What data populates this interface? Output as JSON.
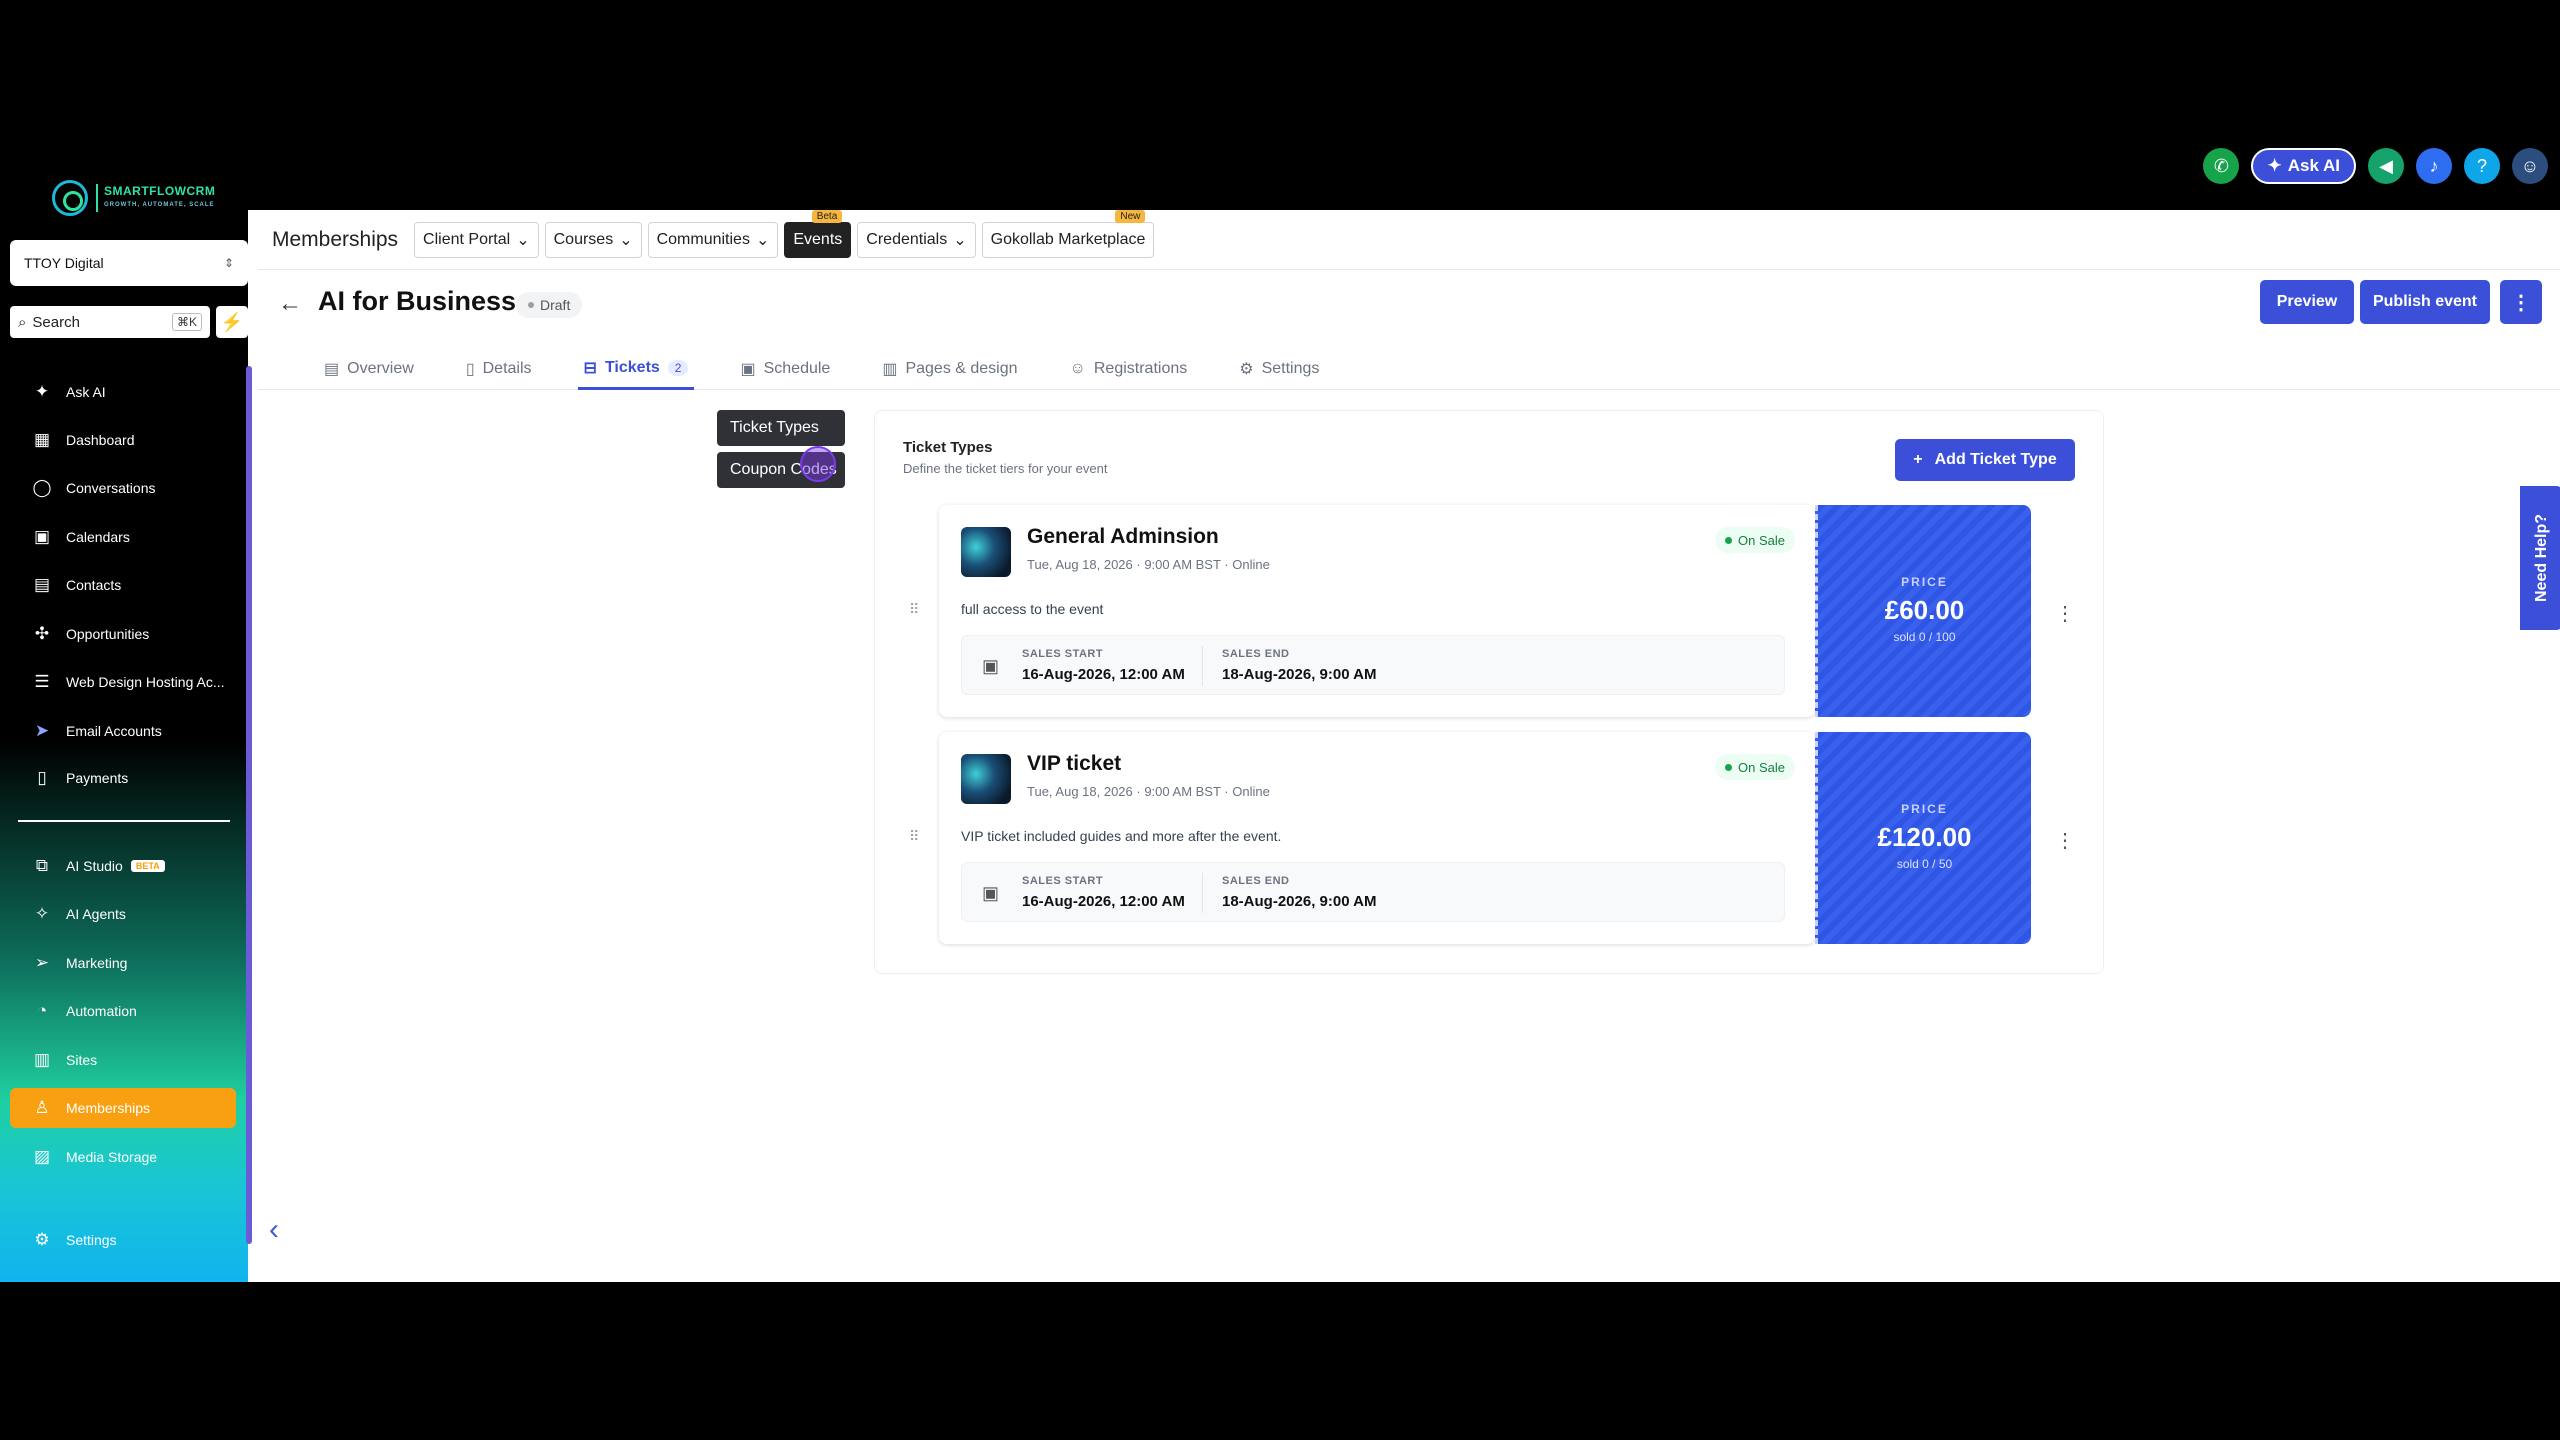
{
  "brand": {
    "logo_text": "SMARTFLOWCRM",
    "logo_sub": "GROWTH, AUTOMATE, SCALE"
  },
  "account": {
    "name": "TTOY Digital"
  },
  "search": {
    "label": "Search",
    "shortcut": "⌘K"
  },
  "topbar": {
    "ask_ai": "Ask AI"
  },
  "sidebar": {
    "items": [
      {
        "label": "Ask AI",
        "icon": "sparkle-icon"
      },
      {
        "label": "Dashboard",
        "icon": "grid-icon"
      },
      {
        "label": "Conversations",
        "icon": "chat-icon"
      },
      {
        "label": "Calendars",
        "icon": "calendar-icon"
      },
      {
        "label": "Contacts",
        "icon": "contacts-icon"
      },
      {
        "label": "Opportunities",
        "icon": "network-icon"
      },
      {
        "label": "Web Design Hosting Ac...",
        "icon": "server-icon"
      },
      {
        "label": "Email Accounts",
        "icon": "send-icon"
      },
      {
        "label": "Payments",
        "icon": "receipt-icon"
      },
      {
        "label": "AI Studio",
        "icon": "ai-studio-icon",
        "badge": "BETA"
      },
      {
        "label": "AI Agents",
        "icon": "agents-icon"
      },
      {
        "label": "Marketing",
        "icon": "marketing-icon"
      },
      {
        "label": "Automation",
        "icon": "automation-icon"
      },
      {
        "label": "Sites",
        "icon": "sites-icon"
      },
      {
        "label": "Memberships",
        "icon": "membership-icon"
      },
      {
        "label": "Media Storage",
        "icon": "image-icon"
      },
      {
        "label": "Settings",
        "icon": "gear-icon"
      }
    ]
  },
  "appbar": {
    "title": "Memberships",
    "nav": [
      {
        "label": "Client Portal",
        "dropdown": true
      },
      {
        "label": "Courses",
        "dropdown": true
      },
      {
        "label": "Communities",
        "dropdown": true
      },
      {
        "label": "Events",
        "tag": "Beta"
      },
      {
        "label": "Credentials",
        "dropdown": true
      },
      {
        "label": "Gokollab Marketplace",
        "tag": "New"
      }
    ]
  },
  "event": {
    "title": "AI for Business",
    "status": "Draft",
    "preview": "Preview",
    "publish": "Publish event"
  },
  "tabs": [
    {
      "label": "Overview"
    },
    {
      "label": "Details"
    },
    {
      "label": "Tickets",
      "count": "2"
    },
    {
      "label": "Schedule"
    },
    {
      "label": "Pages & design"
    },
    {
      "label": "Registrations"
    },
    {
      "label": "Settings"
    }
  ],
  "subnav": {
    "ticket_types": "Ticket Types",
    "coupon_codes": "Coupon Codes"
  },
  "panel": {
    "title": "Ticket Types",
    "subtitle": "Define the ticket tiers for your event",
    "add_button": "Add Ticket Type"
  },
  "tickets": [
    {
      "name": "General Adminsion",
      "date": "Tue, Aug 18, 2026 · 9:00 AM BST · Online",
      "status": "On Sale",
      "description": "full access to the event",
      "sales_start_label": "SALES START",
      "sales_start": "16-Aug-2026, 12:00 AM",
      "sales_end_label": "SALES END",
      "sales_end": "18-Aug-2026, 9:00 AM",
      "price_label": "PRICE",
      "price": "£60.00",
      "sold": "sold 0 / 100"
    },
    {
      "name": "VIP ticket",
      "date": "Tue, Aug 18, 2026 · 9:00 AM BST · Online",
      "status": "On Sale",
      "description": "VIP ticket included guides and more after the event.",
      "sales_start_label": "SALES START",
      "sales_start": "16-Aug-2026, 12:00 AM",
      "sales_end_label": "SALES END",
      "sales_end": "18-Aug-2026, 9:00 AM",
      "price_label": "PRICE",
      "price": "£120.00",
      "sold": "sold 0 / 50"
    }
  ],
  "help": {
    "label": "Need Help?"
  },
  "colors": {
    "accent": "#3b4fd9",
    "active_nav": "#f9a012",
    "on_sale": "#16a34a"
  }
}
